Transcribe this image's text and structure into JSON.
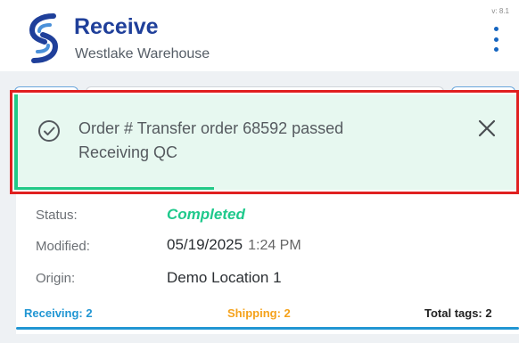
{
  "header": {
    "title": "Receive",
    "subtitle": "Westlake Warehouse",
    "version": "v: 8.1",
    "logo_icon": "logo-s-icon",
    "menu_icon": "more-vert-icon"
  },
  "toast": {
    "message": "Order # Transfer order 68592 passed Receiving QC",
    "icon": "check-circle-icon",
    "close_icon": "close-icon",
    "accent_color": "#22c987"
  },
  "details": {
    "status_label": "Status:",
    "status_value": "Completed",
    "modified_label": "Modified:",
    "modified_date": "05/19/2025",
    "modified_time": "1:24 PM",
    "origin_label": "Origin:",
    "origin_value": "Demo Location 1"
  },
  "footer": {
    "receiving": "Receiving: 2",
    "shipping": "Shipping: 2",
    "total_tags": "Total tags: 2"
  },
  "colors": {
    "brand": "#1f3f9a",
    "completed": "#1fc98c",
    "receiving": "#2196d3",
    "shipping": "#f5a21b",
    "error_outline": "#e02020"
  }
}
